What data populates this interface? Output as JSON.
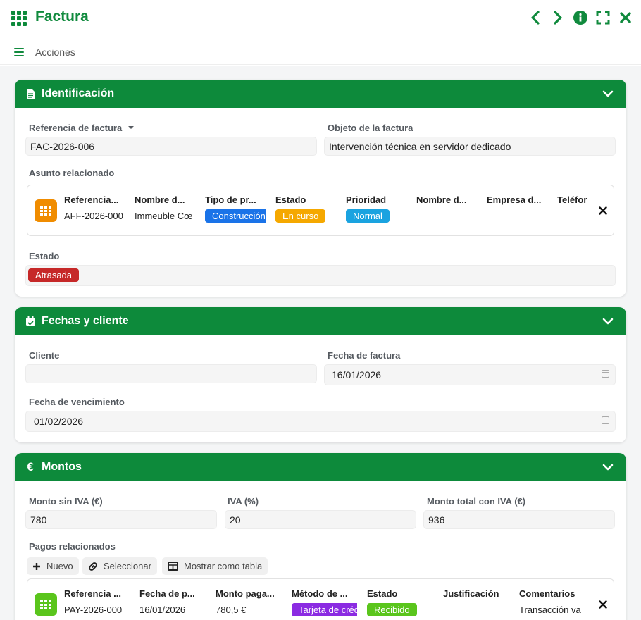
{
  "header": {
    "title": "Factura",
    "menu_label": "Acciones"
  },
  "icons": {
    "app": "grid-icon",
    "prev": "chevron-left-icon",
    "next": "chevron-right-icon",
    "info": "info-icon",
    "fullscreen": "expand-icon",
    "close": "close-icon"
  },
  "colors": {
    "brand_green": "#0d8a3b",
    "tag_blue": "#1a73e8",
    "tag_orange": "#f5a800",
    "tag_cyan": "#1aa3e0",
    "tag_red": "#c62828",
    "tag_purple": "#8b2be2",
    "tag_green": "#5ac51c",
    "orange_icon": "#f08c00",
    "green_icon": "#5ac51c"
  },
  "identificacion": {
    "title": "Identificación",
    "ref_label": "Referencia de factura",
    "ref_value": "FAC-2026-006",
    "objeto_label": "Objeto de la factura",
    "objeto_value": "Intervención técnica en servidor dedicado",
    "asunto_label": "Asunto relacionado",
    "asunto": {
      "columns": [
        "Referencia...",
        "Nombre d...",
        "Tipo de pr...",
        "Estado",
        "Prioridad",
        "Nombre d...",
        "Empresa d...",
        "Teléfor"
      ],
      "values": {
        "referencia": "AFF-2026-000",
        "nombre": "Immeuble Cœ",
        "tipo": "Construcción",
        "estado": "En curso",
        "prioridad": "Normal"
      }
    },
    "estado_label": "Estado",
    "estado_value": "Atrasada"
  },
  "fechas": {
    "title": "Fechas y cliente",
    "cliente_label": "Cliente",
    "cliente_value": "",
    "fecha_factura_label": "Fecha de factura",
    "fecha_factura_value": "16/01/2026",
    "vencimiento_label": "Fecha de vencimiento",
    "vencimiento_value": "01/02/2026"
  },
  "montos": {
    "title": "Montos",
    "sin_iva_label": "Monto sin IVA (€)",
    "sin_iva_value": "780",
    "iva_label": "IVA (%)",
    "iva_value": "20",
    "total_label": "Monto total con IVA (€)",
    "total_value": "936",
    "pagos_label": "Pagos relacionados",
    "btn_nuevo": "Nuevo",
    "btn_seleccionar": "Seleccionar",
    "btn_tabla": "Mostrar como tabla",
    "pago": {
      "columns": [
        "Referencia ...",
        "Fecha de p...",
        "Monto paga...",
        "Método de ...",
        "Estado",
        "Justificación",
        "Comentarios"
      ],
      "values": {
        "referencia": "PAY-2026-000",
        "fecha": "16/01/2026",
        "monto": "780,5 €",
        "metodo": "Tarjeta de crédito",
        "estado": "Recibido",
        "justificacion": "",
        "comentarios": "Transacción va"
      }
    }
  }
}
